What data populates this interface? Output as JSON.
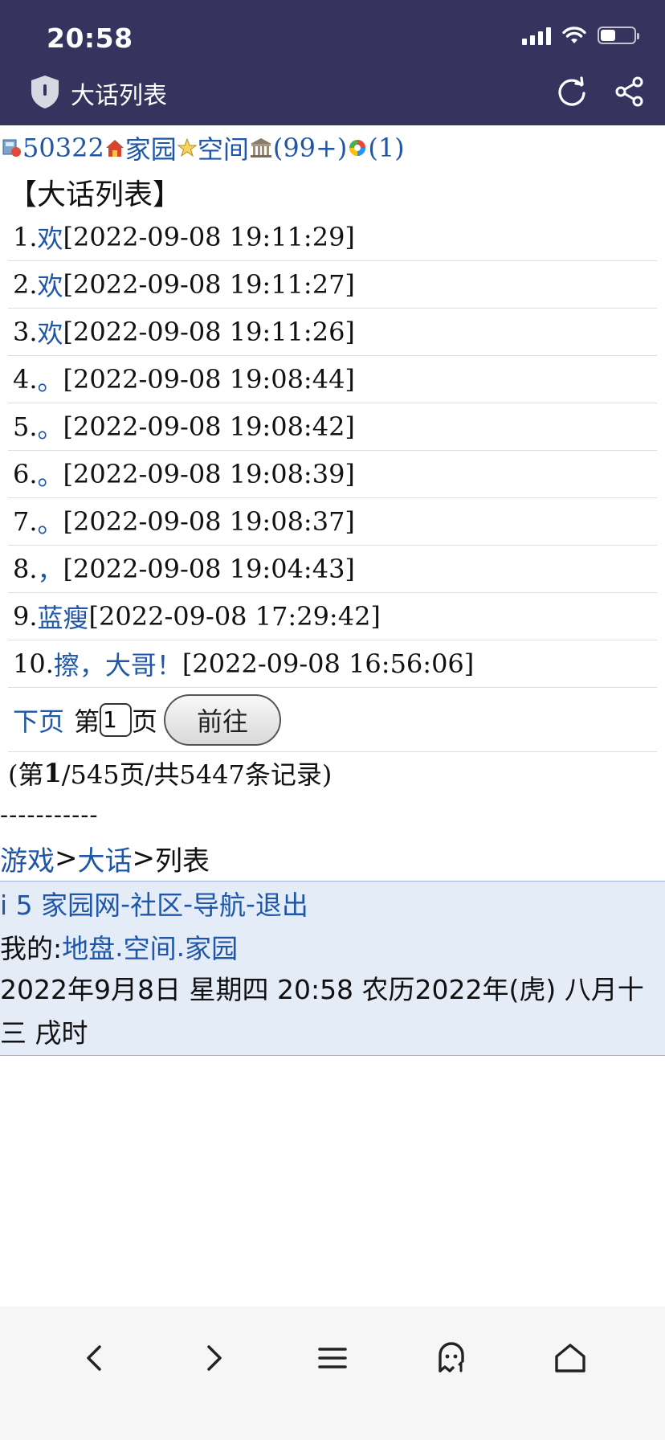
{
  "status_bar": {
    "time": "20:58",
    "battery_level": 0.45
  },
  "title_bar": {
    "title": "大话列表"
  },
  "top_links": {
    "user_id": "50322",
    "home": "家园",
    "space": "空间",
    "messages": "(99+)",
    "notices": "(1)"
  },
  "section_title": "【大话列表】",
  "list": [
    {
      "num": "1.",
      "title": "欢",
      "time": "[2022-09-08 19:11:29]"
    },
    {
      "num": "2.",
      "title": "欢",
      "time": "[2022-09-08 19:11:27]"
    },
    {
      "num": "3.",
      "title": "欢",
      "time": "[2022-09-08 19:11:26]"
    },
    {
      "num": "4.",
      "title": "。",
      "time": "[2022-09-08 19:08:44]"
    },
    {
      "num": "5.",
      "title": "。",
      "time": "[2022-09-08 19:08:42]"
    },
    {
      "num": "6.",
      "title": "。",
      "time": "[2022-09-08 19:08:39]"
    },
    {
      "num": "7.",
      "title": "。",
      "time": "[2022-09-08 19:08:37]"
    },
    {
      "num": "8.",
      "title": "，",
      "time": "[2022-09-08 19:04:43]"
    },
    {
      "num": "9.",
      "title": "蓝瘦",
      "time": "[2022-09-08 17:29:42]"
    },
    {
      "num": "10.",
      "title": "擦，大哥！",
      "time": "[2022-09-08 16:56:06]"
    }
  ],
  "pager": {
    "next_label": "下页",
    "prefix": "第",
    "page_value": "1",
    "suffix": "页",
    "go_label": "前往"
  },
  "summary": {
    "open": "(第",
    "current": "1",
    "rest": "/545页/共5447条记录)"
  },
  "divider": "-----------",
  "breadcrumb": {
    "games": "游戏",
    "sep1": ">",
    "dahua": "大话",
    "sep2": ">",
    "current": "列表"
  },
  "footer": {
    "site": "i 5 家园网",
    "sep1": "-",
    "community": "社区",
    "sep2": "-",
    "nav": "导航",
    "sep3": "-",
    "logout": "退出",
    "mine_label": "我的:",
    "territory": "地盘",
    "dot1": ".",
    "space": "空间",
    "dot2": ".",
    "home": "家园",
    "date": "2022年9月8日  星期四  20:58  农历2022年(虎)  八月十三  戌时"
  }
}
